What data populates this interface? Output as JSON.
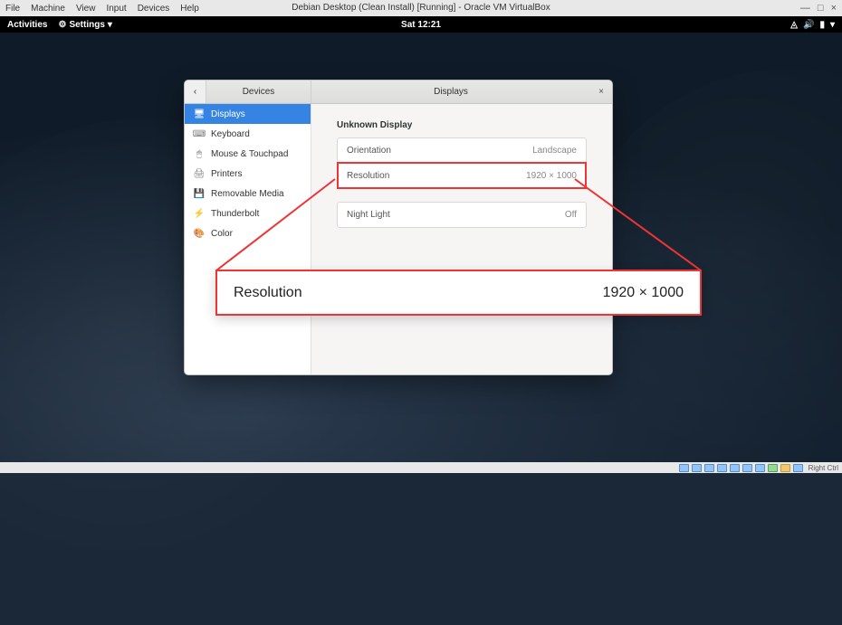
{
  "vbox": {
    "menu": [
      "File",
      "Machine",
      "View",
      "Input",
      "Devices",
      "Help"
    ],
    "title": "Debian Desktop (Clean Install) [Running] - Oracle VM VirtualBox",
    "minimize": "—",
    "maximize": "□",
    "close": "×",
    "host_key": "Right Ctrl"
  },
  "gnome": {
    "activities": "Activities",
    "settings": "Settings",
    "clock": "Sat 12:21",
    "icons": [
      "network-icon",
      "volume-icon",
      "battery-icon",
      "power-icon"
    ]
  },
  "dialog": {
    "back_glyph": "‹",
    "devices": "Devices",
    "title": "Displays",
    "close_glyph": "×",
    "sidebar": [
      {
        "icon": "🖥",
        "label": "Displays",
        "active": true
      },
      {
        "icon": "⌨",
        "label": "Keyboard",
        "active": false
      },
      {
        "icon": "🖱",
        "label": "Mouse & Touchpad",
        "active": false
      },
      {
        "icon": "🖨",
        "label": "Printers",
        "active": false
      },
      {
        "icon": "💾",
        "label": "Removable Media",
        "active": false
      },
      {
        "icon": "⚡",
        "label": "Thunderbolt",
        "active": false
      },
      {
        "icon": "🎨",
        "label": "Color",
        "active": false
      }
    ],
    "display_name": "Unknown Display",
    "rows": {
      "orientation": {
        "label": "Orientation",
        "value": "Landscape"
      },
      "resolution": {
        "label": "Resolution",
        "value": "1920 × 1000"
      },
      "night_light": {
        "label": "Night Light",
        "value": "Off"
      }
    }
  },
  "callout": {
    "label": "Resolution",
    "value": "1920 × 1000"
  }
}
